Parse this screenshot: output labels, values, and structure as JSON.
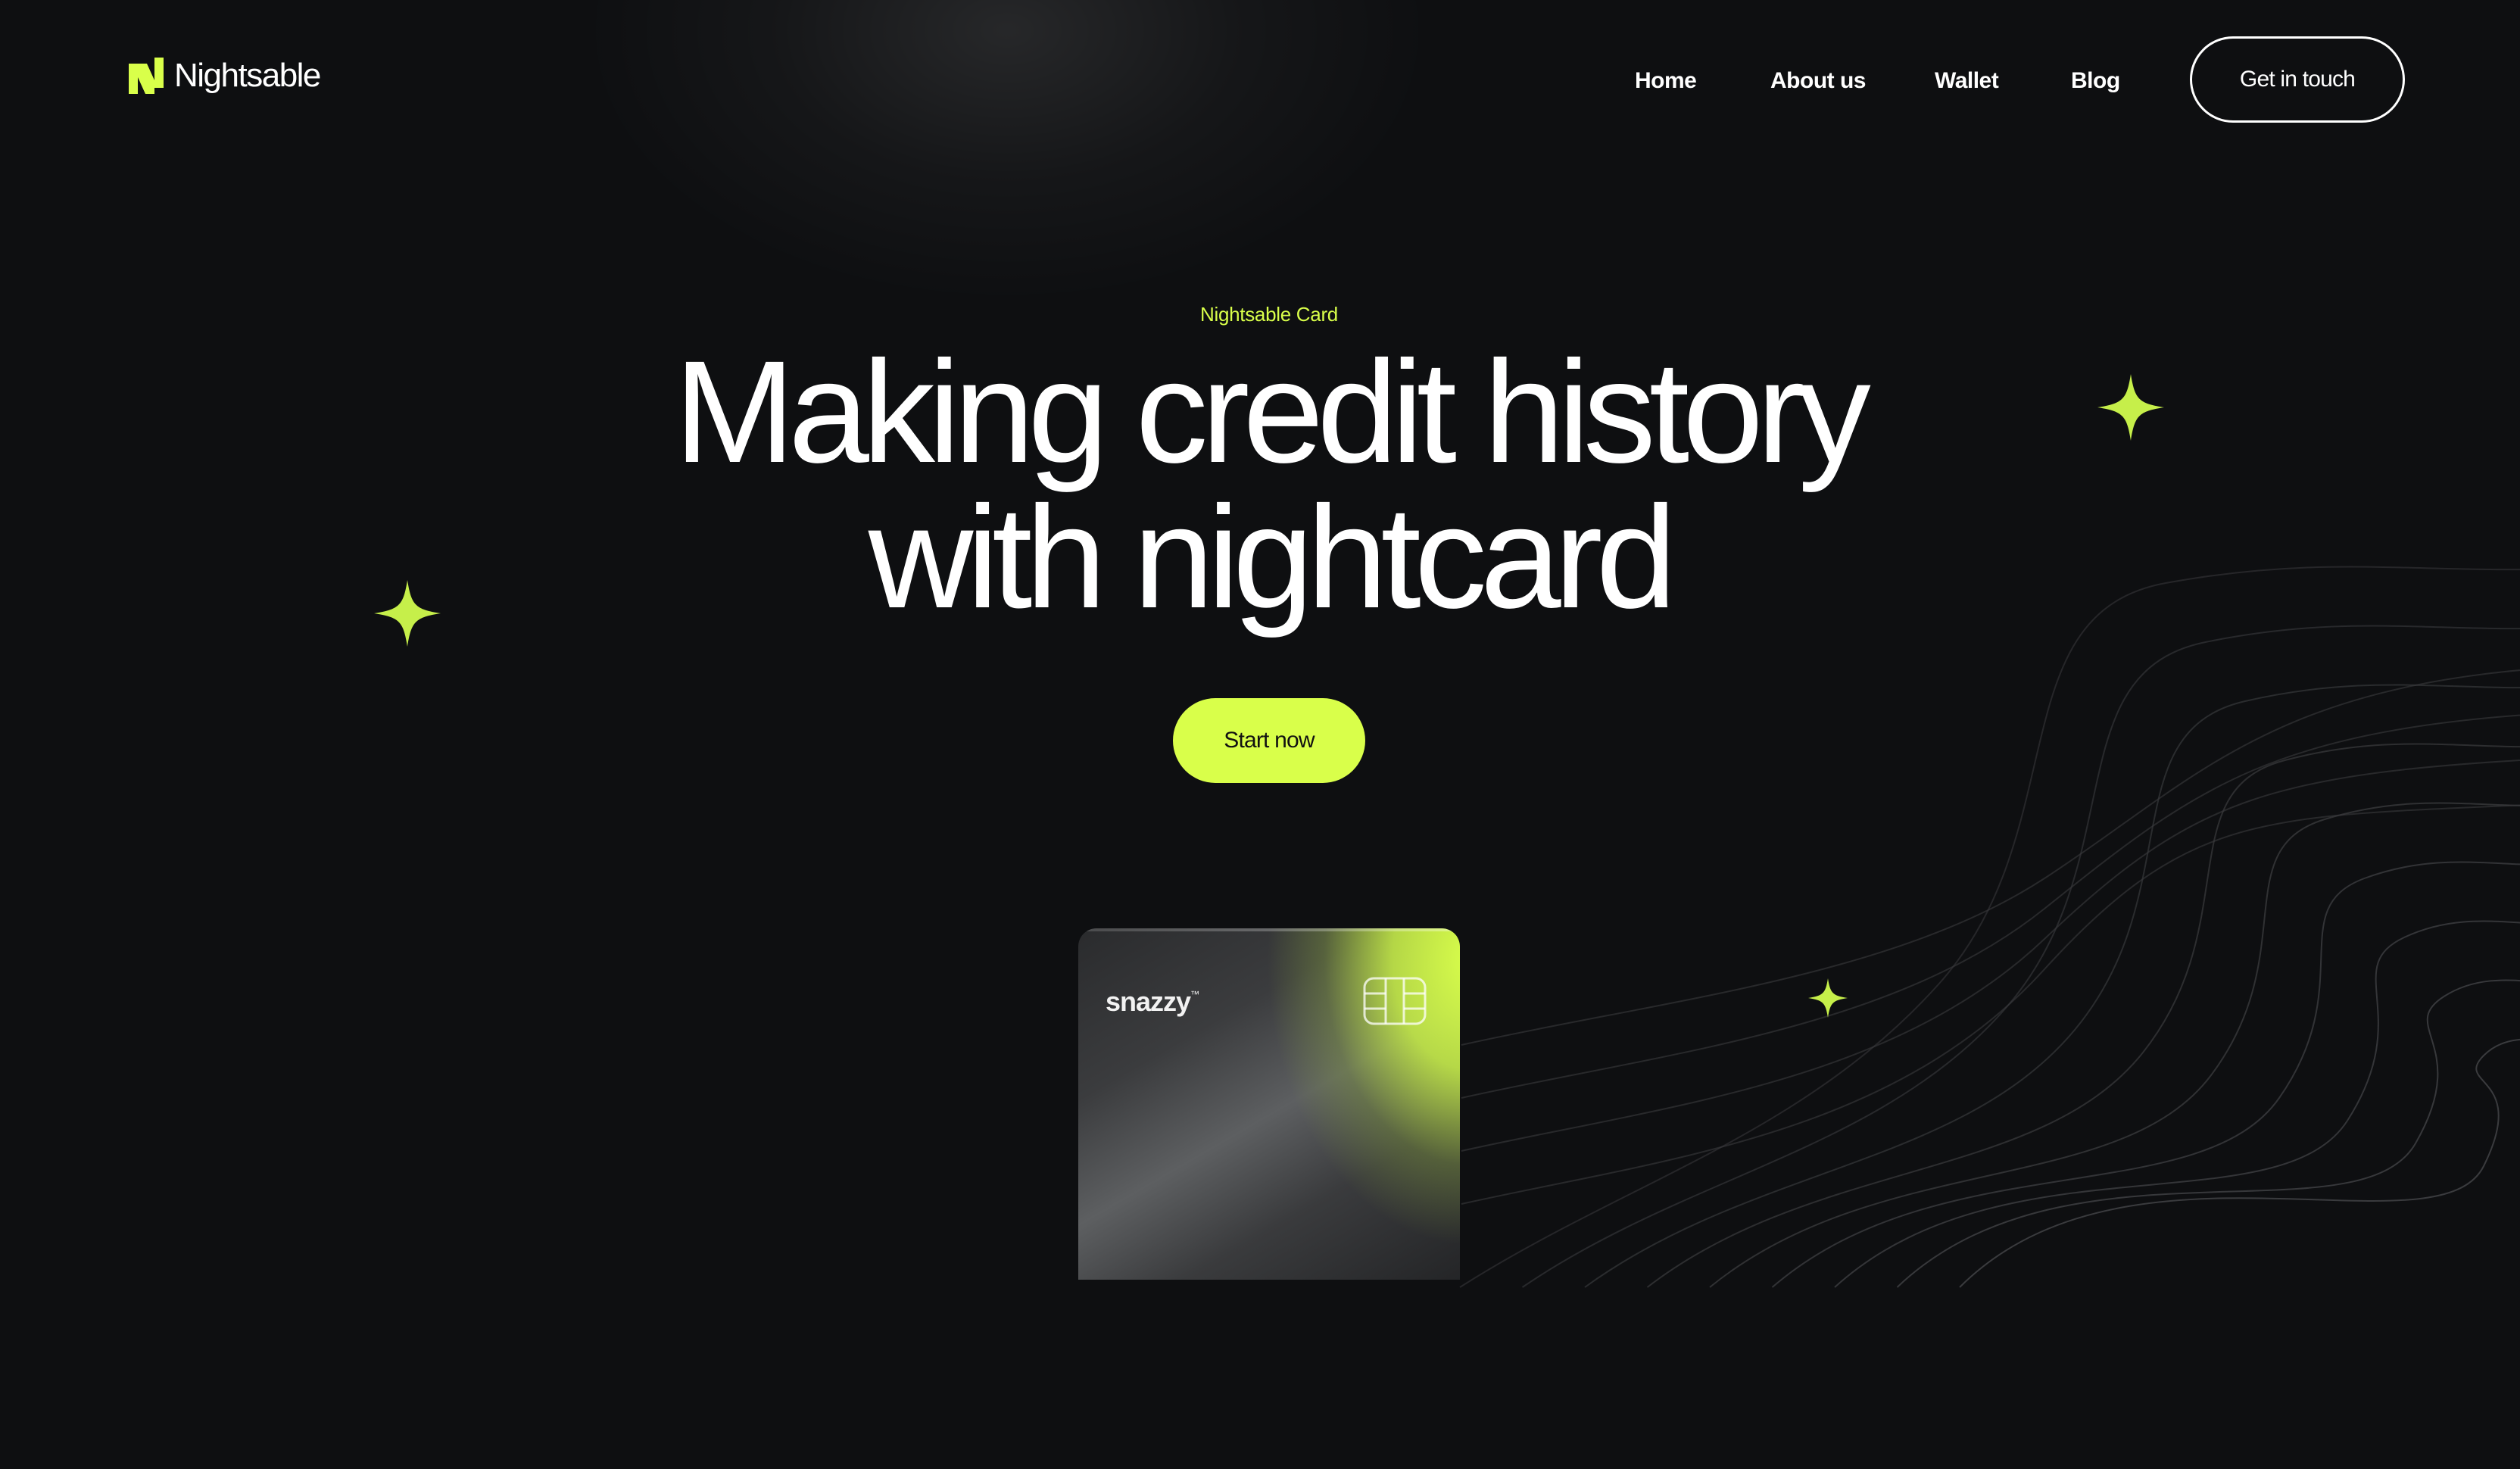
{
  "brand": {
    "name": "Nightsable",
    "accent_color": "#d9ff4a",
    "logo_icon": "n-logo-icon"
  },
  "nav": {
    "links": [
      {
        "label": "Home"
      },
      {
        "label": "About us"
      },
      {
        "label": "Wallet"
      },
      {
        "label": "Blog"
      }
    ],
    "cta_label": "Get in touch"
  },
  "hero": {
    "eyebrow": "Nightsable Card",
    "headline_line1": "Making credit history",
    "headline_line2": "with nightcard",
    "start_button_label": "Start now"
  },
  "card": {
    "brand": "snazzy",
    "trademark": "™",
    "chip_icon": "chip-icon"
  },
  "decorations": {
    "sparkle_icon": "sparkle-icon",
    "background_color": "#0e0f11"
  }
}
